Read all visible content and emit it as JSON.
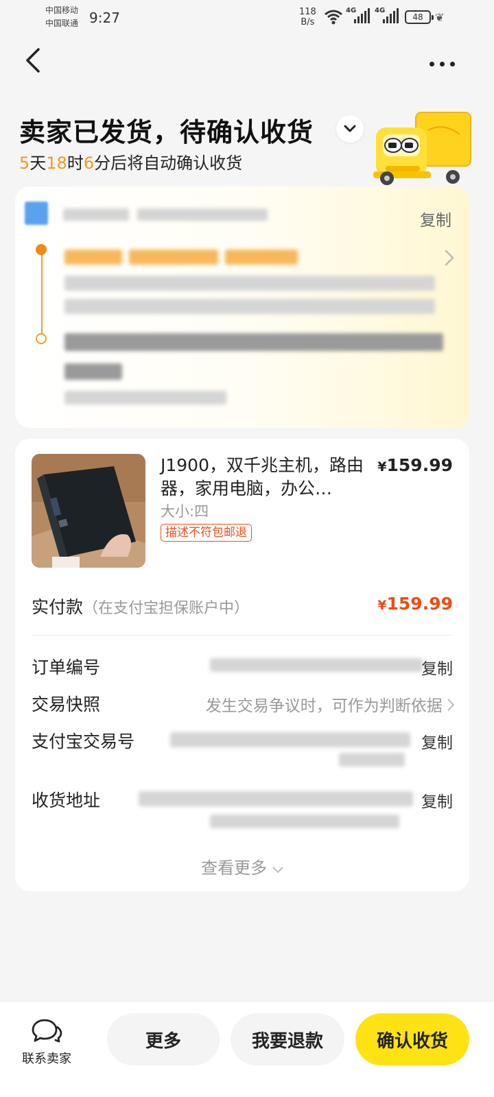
{
  "status_bar": {
    "carrier_1": "中国移动",
    "carrier_2": "中国联通",
    "time": "9:27",
    "net_speed_value": "118",
    "net_speed_unit": "B/s",
    "signal_tag_1": "4G",
    "signal_tag_2": "4G",
    "battery_level": "48"
  },
  "header": {
    "title": "卖家已发货，待确认收货",
    "countdown": {
      "days": "5",
      "days_unit": "天",
      "hours": "18",
      "hours_unit": "时",
      "minutes": "6",
      "minutes_suffix": "分后将自动确认收货"
    }
  },
  "logistics": {
    "copy_label": "复制"
  },
  "product": {
    "title": "J1900，双千兆主机，路由器，家用电脑，办公…",
    "price_symbol": "¥",
    "price": "159.99",
    "spec": "大小:四",
    "tag": "描述不符包邮退"
  },
  "payment": {
    "label": "实付款",
    "note": "（在支付宝担保账户中）",
    "amount_symbol": "¥",
    "amount": "159.99"
  },
  "info": {
    "order_no_label": "订单编号",
    "order_copy": "复制",
    "snapshot_label": "交易快照",
    "snapshot_text": "发生交易争议时，可作为判断依据",
    "alipay_label": "支付宝交易号",
    "alipay_copy": "复制",
    "address_label": "收货地址",
    "address_copy": "复制",
    "view_more": "查看更多"
  },
  "bottom_bar": {
    "contact_label": "联系卖家",
    "more_label": "更多",
    "refund_label": "我要退款",
    "confirm_label": "确认收货"
  },
  "colors": {
    "accent_orange": "#f29a1a",
    "price_red": "#ee4c14",
    "confirm_yellow": "#ffe214"
  }
}
